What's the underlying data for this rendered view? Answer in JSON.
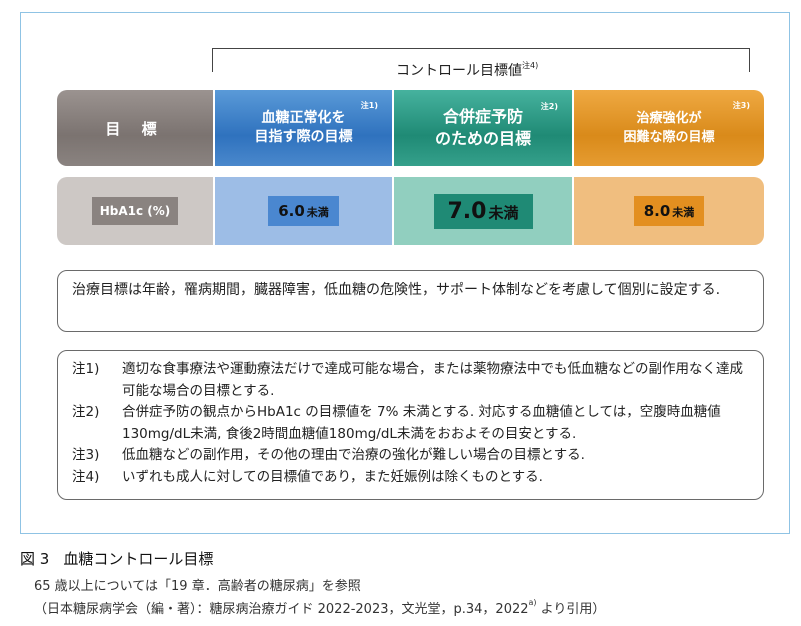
{
  "control_label": "コントロール目標値",
  "control_label_note": "注4)",
  "header_row": {
    "label": "目 標",
    "col1": {
      "line1": "血糖正常化を",
      "line2": "目指す際の目標",
      "note": "注1)"
    },
    "col2": {
      "line1": "合併症予防",
      "line2": "のための目標",
      "note": "注2)"
    },
    "col3": {
      "line1": "治療強化が",
      "line2": "困難な際の目標",
      "note": "注3)"
    }
  },
  "value_row": {
    "label": "HbA1c (%)",
    "col1": {
      "value": "6.0",
      "unit": "未満"
    },
    "col2": {
      "value": "7.0",
      "unit": "未満"
    },
    "col3": {
      "value": "8.0",
      "unit": "未満"
    }
  },
  "info_box": "治療目標は年齢，罹病期間，臓器障害，低血糖の危険性，サポート体制などを考慮して個別に設定する.",
  "notes": [
    {
      "label": "注1)",
      "text": "適切な食事療法や運動療法だけで達成可能な場合，または薬物療法中でも低血糖などの副作用なく達成可能な場合の目標とする."
    },
    {
      "label": "注2)",
      "text": "合併症予防の観点からHbA1c の目標値を 7% 未満とする. 対応する血糖値としては，空腹時血糖値130mg/dL未満, 食後2時間血糖値180mg/dL未満をおおよその目安とする."
    },
    {
      "label": "注3)",
      "text": "低血糖などの副作用，その他の理由で治療の強化が難しい場合の目標とする."
    },
    {
      "label": "注4)",
      "text": "いずれも成人に対しての目標値であり，また妊娠例は除くものとする."
    }
  ],
  "figure": {
    "number": "図 3",
    "title": "血糖コントロール目標",
    "caption1": "65 歳以上については「19 章．高齢者の糖尿病」を参照",
    "caption2_main": "（日本糖尿病学会（編・著）：糖尿病治療ガイド 2022-2023，文光堂，p.34，2022",
    "caption2_sup": "a)",
    "caption2_end": " より引用）"
  }
}
